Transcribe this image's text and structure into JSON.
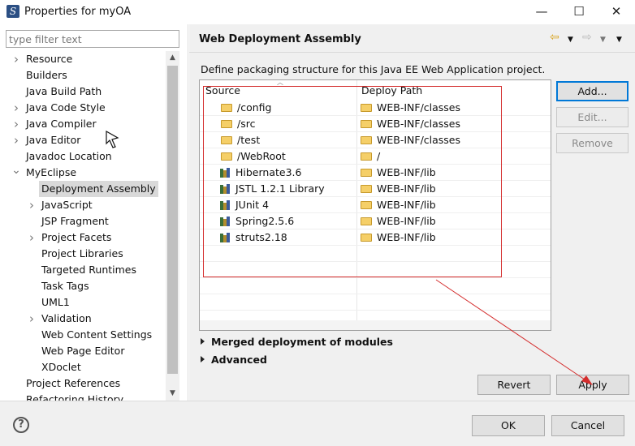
{
  "window": {
    "title": "Properties for myOA",
    "app_icon": "S",
    "minimize": "—",
    "maximize": "☐",
    "close": "✕"
  },
  "filter": {
    "placeholder": "type filter text"
  },
  "tree": [
    {
      "label": "Resource",
      "level": 0,
      "twisty": "collapsed"
    },
    {
      "label": "Builders",
      "level": 0,
      "twisty": "none"
    },
    {
      "label": "Java Build Path",
      "level": 0,
      "twisty": "none"
    },
    {
      "label": "Java Code Style",
      "level": 0,
      "twisty": "collapsed"
    },
    {
      "label": "Java Compiler",
      "level": 0,
      "twisty": "collapsed"
    },
    {
      "label": "Java Editor",
      "level": 0,
      "twisty": "collapsed"
    },
    {
      "label": "Javadoc Location",
      "level": 0,
      "twisty": "none"
    },
    {
      "label": "MyEclipse",
      "level": 0,
      "twisty": "expanded"
    },
    {
      "label": "Deployment Assembly",
      "level": 1,
      "twisty": "none",
      "selected": true
    },
    {
      "label": "JavaScript",
      "level": 1,
      "twisty": "collapsed"
    },
    {
      "label": "JSP Fragment",
      "level": 1,
      "twisty": "none"
    },
    {
      "label": "Project Facets",
      "level": 1,
      "twisty": "collapsed"
    },
    {
      "label": "Project Libraries",
      "level": 1,
      "twisty": "none"
    },
    {
      "label": "Targeted Runtimes",
      "level": 1,
      "twisty": "none"
    },
    {
      "label": "Task Tags",
      "level": 1,
      "twisty": "none"
    },
    {
      "label": "UML1",
      "level": 1,
      "twisty": "none"
    },
    {
      "label": "Validation",
      "level": 1,
      "twisty": "collapsed"
    },
    {
      "label": "Web Content Settings",
      "level": 1,
      "twisty": "none"
    },
    {
      "label": "Web Page Editor",
      "level": 1,
      "twisty": "none"
    },
    {
      "label": "XDoclet",
      "level": 1,
      "twisty": "none"
    },
    {
      "label": "Project References",
      "level": 0,
      "twisty": "none"
    },
    {
      "label": "Refactoring History",
      "level": 0,
      "twisty": "none"
    }
  ],
  "page": {
    "title": "Web Deployment Assembly",
    "description": "Define packaging structure for this Java EE Web Application project."
  },
  "table": {
    "headers": [
      "Source",
      "Deploy Path"
    ],
    "rows": [
      {
        "source": "/config",
        "source_icon": "folder-icon",
        "deploy": "WEB-INF/classes"
      },
      {
        "source": "/src",
        "source_icon": "folder-icon",
        "deploy": "WEB-INF/classes"
      },
      {
        "source": "/test",
        "source_icon": "folder-icon",
        "deploy": "WEB-INF/classes"
      },
      {
        "source": "/WebRoot",
        "source_icon": "folder-icon",
        "deploy": "/"
      },
      {
        "source": "Hibernate3.6",
        "source_icon": "library-icon",
        "deploy": "WEB-INF/lib"
      },
      {
        "source": "JSTL 1.2.1 Library",
        "source_icon": "library-icon",
        "deploy": "WEB-INF/lib"
      },
      {
        "source": "JUnit 4",
        "source_icon": "library-icon",
        "deploy": "WEB-INF/lib"
      },
      {
        "source": "Spring2.5.6",
        "source_icon": "library-icon",
        "deploy": "WEB-INF/lib"
      },
      {
        "source": "struts2.18",
        "source_icon": "library-icon",
        "deploy": "WEB-INF/lib"
      }
    ]
  },
  "side_buttons": {
    "add": "Add...",
    "edit": "Edit...",
    "remove": "Remove"
  },
  "sections": {
    "merged": "Merged deployment of modules",
    "advanced": "Advanced"
  },
  "page_buttons": {
    "revert": "Revert",
    "apply": "Apply"
  },
  "dialog_buttons": {
    "help": "?",
    "ok": "OK",
    "cancel": "Cancel"
  },
  "colors": {
    "annotation": "#d42d2d",
    "default_button_border": "#0078d7",
    "selection": "#d9d9d9"
  }
}
